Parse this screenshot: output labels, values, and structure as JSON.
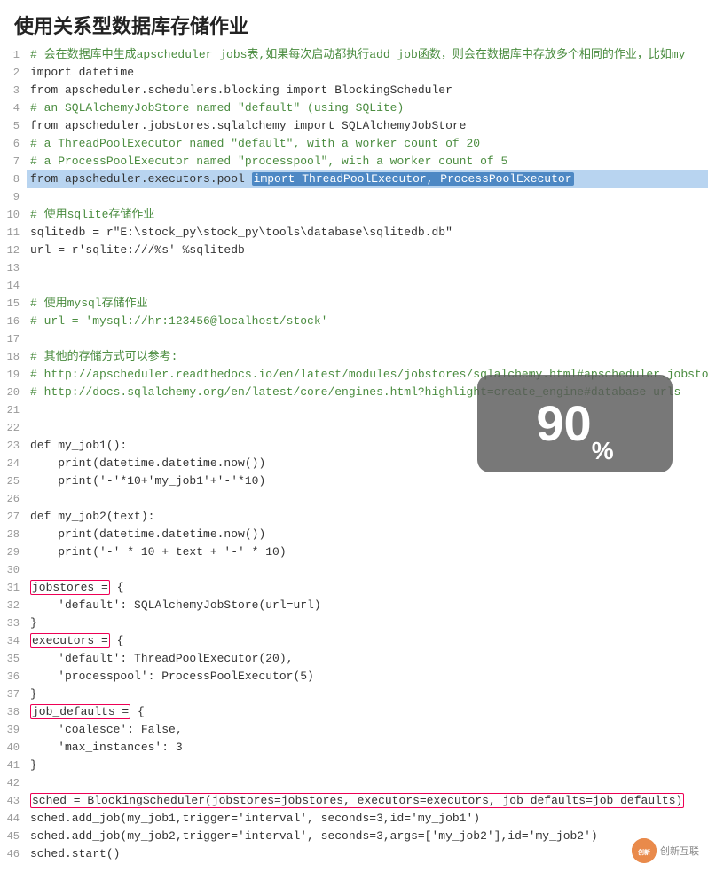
{
  "title": "使用关系型数据库存储作业",
  "percent": "90",
  "percent_sign": "%",
  "lines": [
    {
      "num": 1,
      "text": "# 会在数据库中生成apscheduler_jobs表,如果每次启动都执行add_job函数，则会在数据库中存放多个相同的作业，比如my_",
      "type": "comment"
    },
    {
      "num": 2,
      "text": "import datetime",
      "type": "code"
    },
    {
      "num": 3,
      "text": "from apscheduler.schedulers.blocking import BlockingScheduler",
      "type": "code"
    },
    {
      "num": 4,
      "text": "# an SQLAlchemyJobStore named \"default\" (using SQLite)",
      "type": "comment"
    },
    {
      "num": 5,
      "text": "from apscheduler.jobstores.sqlalchemy import SQLAlchemyJobStore",
      "type": "code"
    },
    {
      "num": 6,
      "text": "# a ThreadPoolExecutor named \"default\", with a worker count of 20",
      "type": "comment"
    },
    {
      "num": 7,
      "text": "# a ProcessPoolExecutor named \"processpool\", with a worker count of 5",
      "type": "comment"
    },
    {
      "num": 8,
      "text": "from apscheduler.executors.pool ",
      "type": "highlight",
      "highlight": "import ThreadPoolExecutor, ProcessPoolExecutor"
    },
    {
      "num": 9,
      "text": "",
      "type": "code"
    },
    {
      "num": 10,
      "text": "# 使用sqlite存储作业",
      "type": "comment"
    },
    {
      "num": 11,
      "text": "sqlitedb = r\"E:\\stock_py\\stock_py\\tools\\database\\sqlitedb.db\"",
      "type": "code"
    },
    {
      "num": 12,
      "text": "url = r'sqlite:///%s' %sqlitedb",
      "type": "code"
    },
    {
      "num": 13,
      "text": "",
      "type": "code"
    },
    {
      "num": 14,
      "text": "",
      "type": "code"
    },
    {
      "num": 15,
      "text": "# 使用mysql存储作业",
      "type": "comment"
    },
    {
      "num": 16,
      "text": "# url = 'mysql://hr:123456@localhost/stock'",
      "type": "comment"
    },
    {
      "num": 17,
      "text": "",
      "type": "code"
    },
    {
      "num": 18,
      "text": "# 其他的存储方式可以参考:",
      "type": "comment"
    },
    {
      "num": 19,
      "text": "# http://apscheduler.readthedocs.io/en/latest/modules/jobstores/sqlalchemy.html#apscheduler.jobstores.",
      "type": "comment"
    },
    {
      "num": 20,
      "text": "# http://docs.sqlalchemy.org/en/latest/core/engines.html?highlight=create_engine#database-urls",
      "type": "comment"
    },
    {
      "num": 21,
      "text": "",
      "type": "code"
    },
    {
      "num": 22,
      "text": "",
      "type": "code"
    },
    {
      "num": 23,
      "text": "def my_job1():",
      "type": "code"
    },
    {
      "num": 24,
      "text": "    print(datetime.datetime.now())",
      "type": "code"
    },
    {
      "num": 25,
      "text": "    print('-'*10+'my_job1'+'-'*10)",
      "type": "code"
    },
    {
      "num": 26,
      "text": "",
      "type": "code"
    },
    {
      "num": 27,
      "text": "def my_job2(text):",
      "type": "code"
    },
    {
      "num": 28,
      "text": "    print(datetime.datetime.now())",
      "type": "code"
    },
    {
      "num": 29,
      "text": "    print('-' * 10 + text + '-' * 10)",
      "type": "code"
    },
    {
      "num": 30,
      "text": "",
      "type": "code"
    },
    {
      "num": 31,
      "text": "",
      "type": "code"
    },
    {
      "num": 32,
      "text": "    'default': SQLAlchemyJobStore(url=url)",
      "type": "code",
      "outline_start": true
    },
    {
      "num": 33,
      "text": "}",
      "type": "code"
    },
    {
      "num": 34,
      "text": "",
      "type": "code"
    },
    {
      "num": 35,
      "text": "    'default': ThreadPoolExecutor(20),",
      "type": "code",
      "outline_exec": true
    },
    {
      "num": 36,
      "text": "    'processpool': ProcessPoolExecutor(5)",
      "type": "code"
    },
    {
      "num": 37,
      "text": "}",
      "type": "code"
    },
    {
      "num": 38,
      "text": "",
      "type": "code"
    },
    {
      "num": 39,
      "text": "    'coalesce': False,",
      "type": "code",
      "outline_defaults": true
    },
    {
      "num": 40,
      "text": "    'max_instances': 3",
      "type": "code"
    },
    {
      "num": 41,
      "text": "}",
      "type": "code"
    },
    {
      "num": 42,
      "text": "",
      "type": "code"
    },
    {
      "num": 43,
      "text": "",
      "type": "code"
    },
    {
      "num": 44,
      "text": "sched.add_job(my_job1,trigger='interval', seconds=3,id='my_job1')",
      "type": "code"
    },
    {
      "num": 45,
      "text": "sched.add_job(my_job2,trigger='interval', seconds=3,args=['my_job2'],id='my_job2')",
      "type": "code"
    },
    {
      "num": 46,
      "text": "sched.start()",
      "type": "code"
    }
  ],
  "watermark": {
    "logo": "创新",
    "text": "创新互联"
  }
}
